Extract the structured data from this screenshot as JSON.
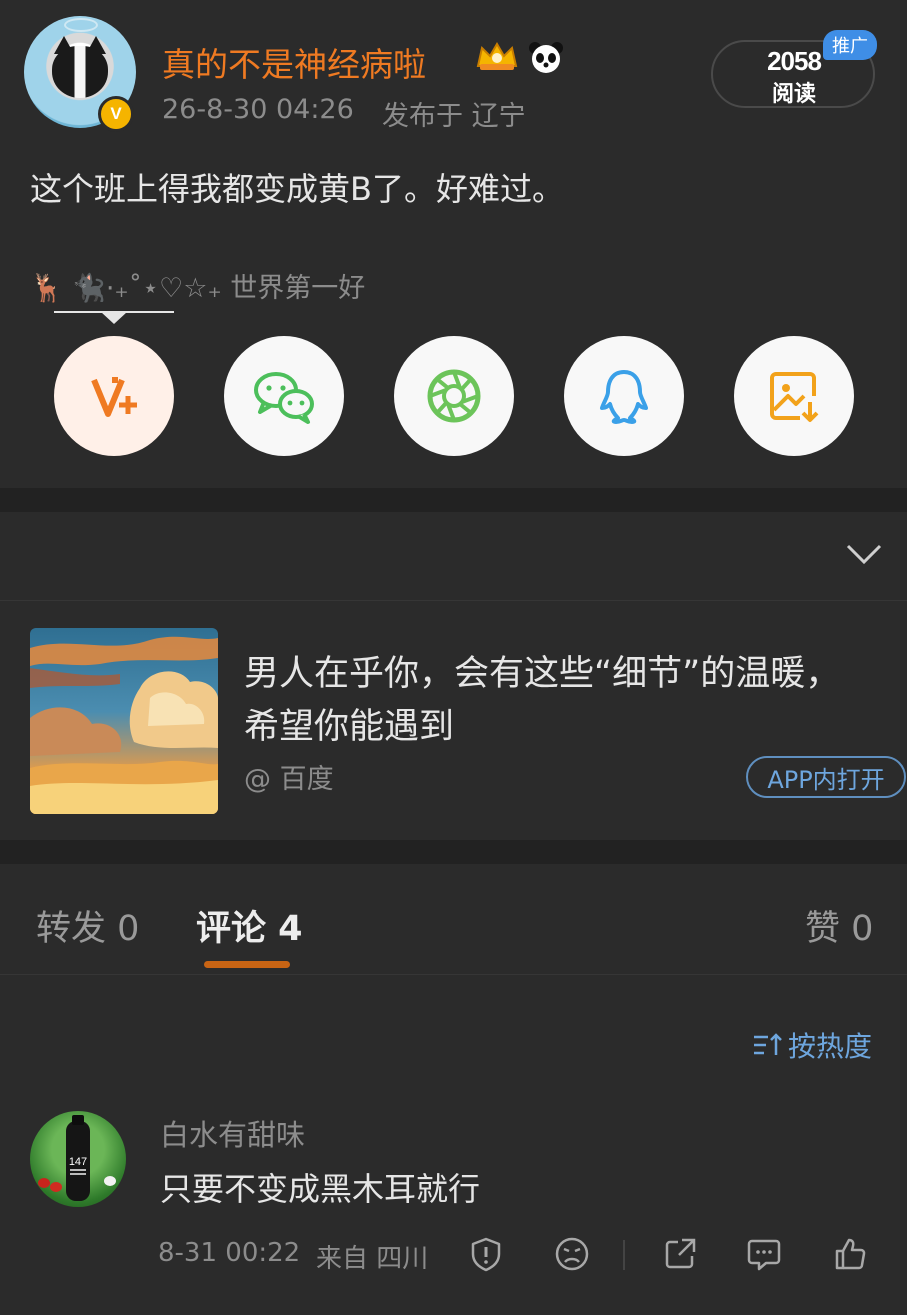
{
  "post": {
    "username": "真的不是神经病啦",
    "time": "26-8-30 04:26",
    "location": "发布于 辽宁",
    "reads_count": "2058",
    "reads_label": "阅读",
    "promo_tag": "推广",
    "text": "这个班上得我都变成黄B了。好难过。",
    "tail": "🦌 🐈‍⬛·₊˚⋆♡☆₊ 世界第一好"
  },
  "share": {
    "items": [
      {
        "icon": "vplus-icon",
        "color": "#ef7a22"
      },
      {
        "icon": "wechat-icon",
        "color": "#4cbf5b"
      },
      {
        "icon": "moments-icon",
        "color": "#6cc45a"
      },
      {
        "icon": "qq-icon",
        "color": "#3aa0e8"
      },
      {
        "icon": "save-image-icon",
        "color": "#f2a21a"
      }
    ]
  },
  "card": {
    "title": "男人在乎你，会有这些“细节”的温暖，希望你能遇到",
    "source": "@ 百度",
    "open_label": "APP内打开"
  },
  "tabs": {
    "repost": "转发 0",
    "comments": "评论 4",
    "likes": "赞 0"
  },
  "sort": {
    "label": "按热度"
  },
  "comment": {
    "name": "白水有甜味",
    "text": "只要不变成黑木耳就行",
    "time": "8-31 00:22",
    "location": "来自 四川",
    "avatar_label": "147"
  },
  "colors": {
    "accent_orange": "#ef7a22",
    "link_blue": "#6ea6de",
    "tab_indicator": "#c86414",
    "background": "#2b2b2b"
  }
}
